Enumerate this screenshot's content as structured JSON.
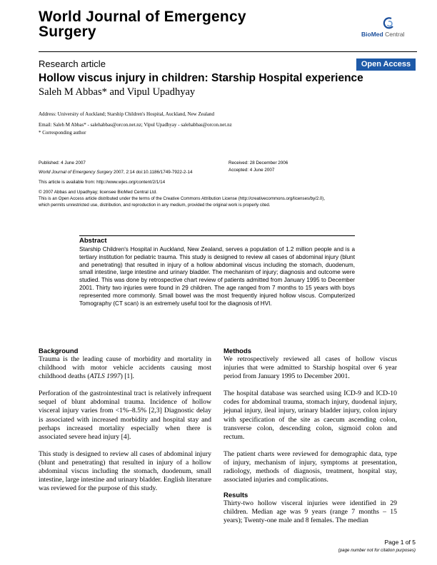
{
  "header": {
    "journal_title": "World Journal of Emergency Surgery",
    "publisher_brand": "BioMed",
    "publisher_suffix": "Central"
  },
  "article": {
    "type": "Research article",
    "open_access": "Open Access",
    "title": "Hollow viscus injury in children: Starship Hospital experience",
    "authors": "Saleh M Abbas* and Vipul Upadhyay",
    "address": "Address: University of Auckland; Starship Children's Hospital, Auckland, New Zealand",
    "email": "Email: Saleh M Abbas* - salehabbas@orcon.net.nz; Vipul Upadhyay - salehabbas@orcon.net.nz",
    "corresponding": "* Corresponding author"
  },
  "meta": {
    "published": "Published: 4 June 2007",
    "citation_journal": "World Journal of Emergency Surgery",
    "citation_rest": " 2007, 2:14    doi:10.1186/1749-7922-2-14",
    "available": "This article is available from: http://www.wjes.org/content/2/1/14",
    "received": "Received: 28 December 2006",
    "accepted": "Accepted: 4 June 2007",
    "copyright": "© 2007 Abbas and Upadhyay; licensee BioMed Central Ltd.",
    "license_1": "This is an Open Access article distributed under the terms of the Creative Commons Attribution License (http://creativecommons.org/licenses/by/2.0),",
    "license_2": "which permits unrestricted use, distribution, and reproduction in any medium, provided the original work is properly cited."
  },
  "abstract": {
    "heading": "Abstract",
    "text": "Starship Children's Hospital in Auckland, New Zealand, serves a population of 1.2 million people and is a tertiary institution for pediatric trauma. This study is designed to review all cases of abdominal injury (blunt and penetrating) that resulted in injury of a hollow abdominal viscus including the stomach, duodenum, small intestine, large intestine and urinary bladder. The mechanism of injury; diagnosis and outcome were studied. This was done by retrospective chart review of patients admitted from January 1995 to December 2001. Thirty two injuries were found in 29 children. The age ranged from 7 months to 15 years with boys represented more commonly. Small bowel was the most frequently injured hollow viscus. Computerized Tomography (CT scan) is an extremely useful tool for the diagnosis of HVI."
  },
  "background": {
    "heading": "Background",
    "p1_a": "Trauma is the leading cause of morbidity and mortality in childhood with motor vehicle accidents causing most childhood deaths (",
    "p1_cite": "ATLS 1997",
    "p1_b": ") [1].",
    "p2": "Perforation of the gastrointestinal tract is relatively infrequent sequel of blunt abdominal trauma. Incidence of hollow visceral injury varies from <1%–8.5% [2,3] Diagnostic delay is associated with increased morbidity and hospital stay and perhaps increased mortality especially when there is associated severe head injury [4].",
    "p3": "This study is designed to review all cases of abdominal injury (blunt and penetrating) that resulted in injury of a hollow abdominal viscus including the stomach, duodenum, small intestine, large intestine and urinary bladder. English literature was reviewed for the purpose of this study."
  },
  "methods": {
    "heading": "Methods",
    "p1": "We retrospectively reviewed all cases of hollow viscus injuries that were admitted to Starship hospital over 6 year period from January 1995 to December 2001.",
    "p2": "The hospital database was searched using ICD-9 and ICD-10 codes for abdominal trauma, stomach injury, duodenal injury, jejunal injury, ileal injury, urinary bladder injury, colon injury with specification of the site as caecum ascending colon, transverse colon, descending colon, sigmoid colon and rectum.",
    "p3": "The patient charts were reviewed for demographic data, type of injury, mechanism of injury, symptoms at presentation, radiology, methods of diagnosis, treatment, hospital stay, associated injuries and complications."
  },
  "results": {
    "heading": "Results",
    "p1": "Thirty-two hollow visceral injuries were identified in 29 children. Median age was 9 years (range 7 months – 15 years); Twenty-one male and 8 females. The median"
  },
  "footer": {
    "page": "Page 1 of 5",
    "note": "(page number not for citation purposes)"
  }
}
